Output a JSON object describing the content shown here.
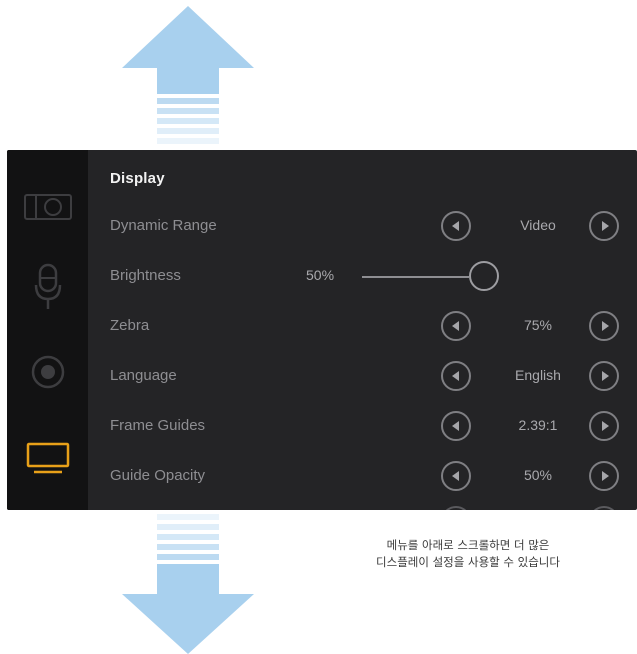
{
  "menu": {
    "section_title": "Display",
    "rows": [
      {
        "label": "Dynamic Range",
        "value": "Video"
      },
      {
        "label": "Brightness",
        "value": "50%"
      },
      {
        "label": "Zebra",
        "value": "75%"
      },
      {
        "label": "Language",
        "value": "English"
      },
      {
        "label": "Frame Guides",
        "value": "2.39:1"
      },
      {
        "label": "Guide Opacity",
        "value": "50%"
      }
    ],
    "brightness_level": 0.5
  },
  "sidebar": {
    "tabs": [
      {
        "icon": "camera-icon",
        "active": false
      },
      {
        "icon": "microphone-icon",
        "active": false
      },
      {
        "icon": "record-icon",
        "active": false
      },
      {
        "icon": "monitor-icon",
        "active": true
      }
    ],
    "accent_color": "#e8a019"
  },
  "caption": {
    "line1": "메뉴를 아래로 스크롤하면 더 많은",
    "line2": "디스플레이 설정을 사용할 수 있습니다"
  },
  "colors": {
    "arrow": "#a8d0ee",
    "panel_bg": "#242426",
    "sidebar_bg": "#121213"
  }
}
